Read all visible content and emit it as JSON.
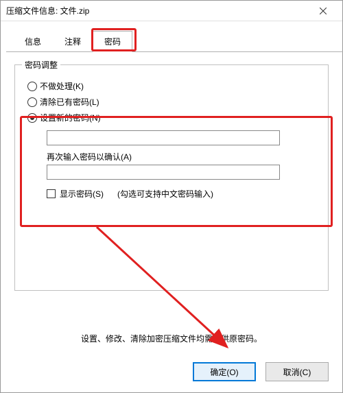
{
  "titlebar": {
    "title": "压缩文件信息: 文件.zip"
  },
  "tabs": [
    {
      "label": "信息"
    },
    {
      "label": "注释"
    },
    {
      "label": "密码",
      "active": true
    }
  ],
  "groupbox": {
    "title": "密码调整"
  },
  "radios": {
    "none": {
      "label": "不做处理(K)",
      "checked": false
    },
    "clear": {
      "label": "清除已有密码(L)",
      "checked": false
    },
    "set": {
      "label": "设置新的密码(N)",
      "checked": true
    }
  },
  "fields": {
    "password": {
      "value": ""
    },
    "confirm_label": "再次输入密码以确认(A)",
    "confirm": {
      "value": ""
    }
  },
  "checkbox": {
    "show_password_label": "显示密码(S)",
    "hint": "(勾选可支持中文密码输入)"
  },
  "bottom_note": "设置、修改、清除加密压缩文件均需提供原密码。",
  "buttons": {
    "ok": "确定(O)",
    "cancel": "取消(C)"
  }
}
